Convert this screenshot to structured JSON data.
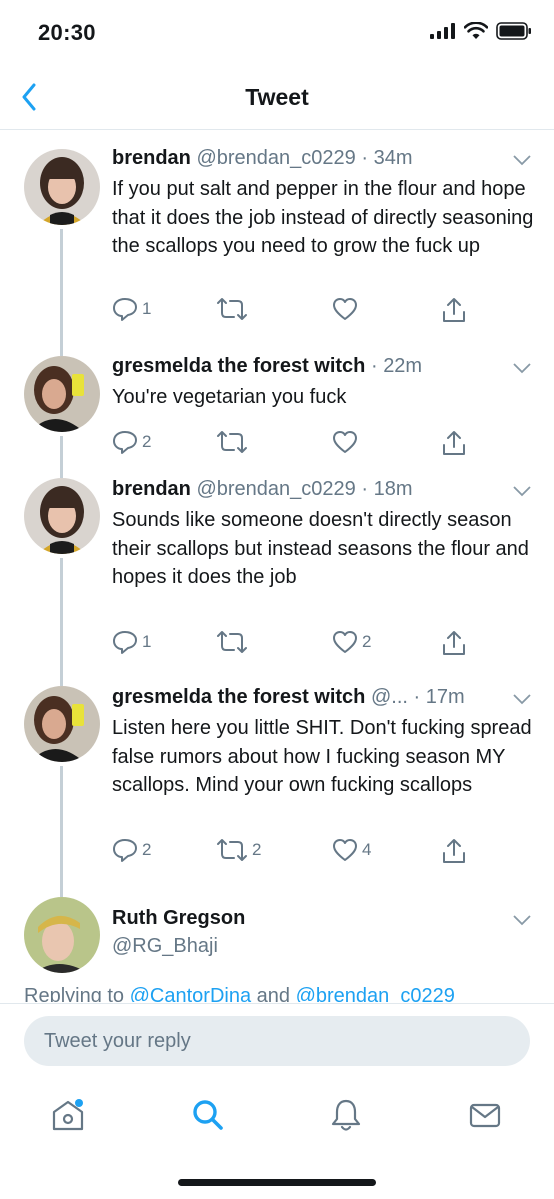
{
  "status_bar": {
    "time": "20:30"
  },
  "nav": {
    "title": "Tweet",
    "back_icon": "chevron-left-icon"
  },
  "tweets": [
    {
      "name": "brendan",
      "handle": "@brendan_c0229",
      "time": "34m",
      "text": "If you put salt and pepper in the flour and hope that it does the job instead of directly seasoning the scallops you need to grow the fuck up",
      "replies": "1",
      "retweets": "",
      "likes": ""
    },
    {
      "name": "gresmelda the forest witch",
      "handle": "",
      "time": "22m",
      "text": "You're vegetarian you fuck",
      "replies": "2",
      "retweets": "",
      "likes": ""
    },
    {
      "name": "brendan",
      "handle": "@brendan_c0229",
      "time": "18m",
      "text": "Sounds like someone doesn't directly season their scallops but instead seasons the flour and hopes it does the job",
      "replies": "1",
      "retweets": "",
      "likes": "2"
    },
    {
      "name": "gresmelda the forest witch",
      "handle": "@...",
      "time": "17m",
      "text": "Listen here you little SHIT. Don't fucking spread false rumors about how I fucking season MY scallops. Mind your own fucking scallops",
      "replies": "2",
      "retweets": "2",
      "likes": "4"
    }
  ],
  "main_tweet": {
    "name": "Ruth Gregson",
    "handle": "@RG_Bhaji",
    "replying_prefix": "Replying to ",
    "replying_user1": "@CantorDina",
    "replying_and": " and ",
    "replying_user2": "@brendan_c0229"
  },
  "reply": {
    "placeholder": "Tweet your reply"
  },
  "tabs": [
    "home-icon",
    "search-icon",
    "notifications-bell-icon",
    "messages-envelope-icon"
  ],
  "colors": {
    "accent": "#1da1f2",
    "text": "#14171a",
    "secondary": "#657786",
    "line": "#c4cfd6"
  }
}
